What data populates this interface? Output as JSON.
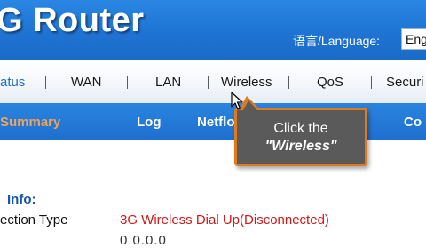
{
  "header": {
    "brand": "G Router",
    "language_label": "语言/Language:",
    "language_value": "Eng"
  },
  "main_nav": {
    "items": [
      "atus",
      "WAN",
      "LAN",
      "Wireless",
      "QoS",
      "Securi"
    ]
  },
  "sub_nav": {
    "items": [
      "Summary",
      "Log",
      "Netflo",
      "Co"
    ]
  },
  "content": {
    "section_title": "Info:",
    "rows": [
      {
        "label": "ection Type",
        "value": "3G Wireless Dial Up(Disconnected)"
      }
    ],
    "dots": "0.0.0.0"
  },
  "callout": {
    "line1": "Click the",
    "line2": "\"Wireless\""
  },
  "colors": {
    "header_blue": "#1f73d3",
    "accent_orange": "#e07a1f",
    "active_sub_orange": "#f0a35a",
    "status_red": "#d01818",
    "callout_gray": "#5a5a5a"
  },
  "icons": {
    "cursor": "mouse-pointer-icon"
  }
}
